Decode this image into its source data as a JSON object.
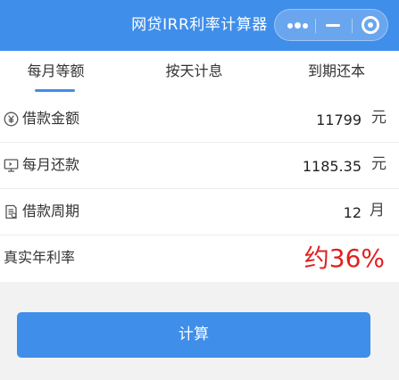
{
  "header": {
    "title": "网贷IRR利率计算器"
  },
  "tabs": [
    {
      "label": "每月等额"
    },
    {
      "label": "按天计息"
    },
    {
      "label": "到期还本"
    }
  ],
  "fields": [
    {
      "icon": "yuan-circle-icon",
      "label": "借款金额",
      "value": "11799",
      "unit": "元"
    },
    {
      "icon": "monitor-icon",
      "label": "每月还款",
      "value": "1185.35",
      "unit": "元"
    },
    {
      "icon": "document-icon",
      "label": "借款周期",
      "value": "12",
      "unit": "月"
    }
  ],
  "result": {
    "label": "真实年利率",
    "value": "约36%"
  },
  "button": {
    "label": "计算"
  },
  "colors": {
    "primary": "#3f8eea",
    "highlight": "#e02020",
    "background": "#f2f2f2"
  }
}
